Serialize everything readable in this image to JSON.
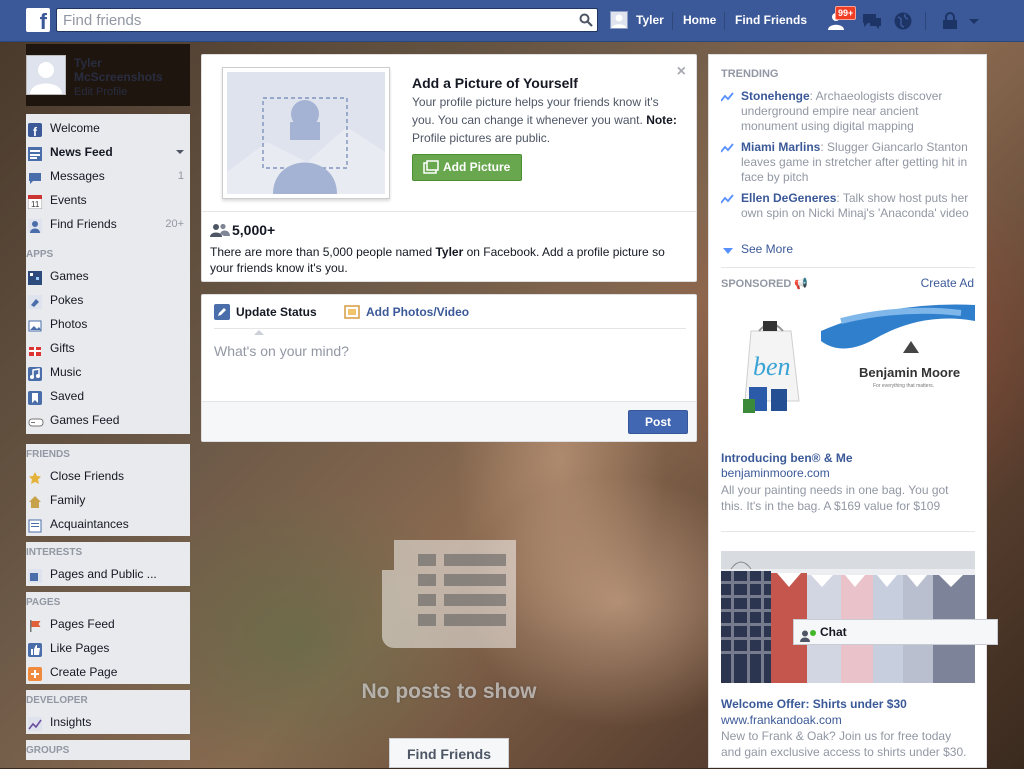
{
  "topbar": {
    "search_placeholder": "Find friends",
    "user_name": "Tyler",
    "home": "Home",
    "find_friends": "Find Friends",
    "friend_requests_badge": "99+"
  },
  "leftnav": {
    "profile": {
      "name": "Tyler McScreenshots",
      "edit": "Edit Profile"
    },
    "favorites": [
      {
        "label": "Welcome",
        "count": "",
        "icon": "fb-icon"
      },
      {
        "label": "News Feed",
        "count": "",
        "icon": "newsfeed-icon"
      },
      {
        "label": "Messages",
        "count": "1",
        "icon": "messages-icon"
      },
      {
        "label": "Events",
        "count": "",
        "icon": "calendar-icon"
      },
      {
        "label": "Find Friends",
        "count": "20+",
        "icon": "find-friends-icon"
      }
    ],
    "apps_heading": "APPS",
    "apps": [
      {
        "label": "Games",
        "icon": "games-icon"
      },
      {
        "label": "Pokes",
        "icon": "pokes-icon"
      },
      {
        "label": "Photos",
        "icon": "photos-icon"
      },
      {
        "label": "Gifts",
        "icon": "gift-icon"
      },
      {
        "label": "Music",
        "icon": "music-icon"
      },
      {
        "label": "Saved",
        "icon": "bookmark-icon"
      },
      {
        "label": "Games Feed",
        "icon": "gamepad-icon"
      }
    ],
    "friends_heading": "FRIENDS",
    "friends": [
      {
        "label": "Close Friends",
        "icon": "star-icon"
      },
      {
        "label": "Family",
        "icon": "house-icon"
      },
      {
        "label": "Acquaintances",
        "icon": "list-icon"
      }
    ],
    "interests_heading": "INTERESTS",
    "interests": [
      {
        "label": "Pages and Public ...",
        "icon": "rss-icon"
      }
    ],
    "pages_heading": "PAGES",
    "pages": [
      {
        "label": "Pages Feed",
        "icon": "flag-icon"
      },
      {
        "label": "Like Pages",
        "icon": "thumbs-up-icon"
      },
      {
        "label": "Create Page",
        "icon": "plus-icon"
      }
    ],
    "developer_heading": "DEVELOPER",
    "developer": [
      {
        "label": "Insights",
        "icon": "chart-icon"
      }
    ],
    "groups_heading": "GROUPS"
  },
  "addpic": {
    "title": "Add a Picture of Yourself",
    "desc": "Your profile picture helps your friends know it's you. You can change it whenever you want.",
    "note_label": "Note:",
    "note_text": " Profile pictures are public.",
    "button": "Add Picture",
    "close": "×",
    "count": "5,000+",
    "count_text_1": "There are more than 5,000 people named ",
    "count_name": "Tyler",
    "count_text_2": " on Facebook. Add a profile picture so your friends know it's you."
  },
  "composer": {
    "tab_status": "Update Status",
    "tab_photos": "Add Photos/Video",
    "placeholder": "What's on your mind?",
    "post": "Post"
  },
  "feed": {
    "empty": "No posts to show",
    "find_friends": "Find Friends"
  },
  "right": {
    "trending_heading": "TRENDING",
    "trending": [
      {
        "name": "Stonehenge",
        "text": ": Archaeologists discover underground empire near ancient monument using digital mapping"
      },
      {
        "name": "Miami Marlins",
        "text": ": Slugger Giancarlo Stanton leaves game in stretcher after getting hit in face by pitch"
      },
      {
        "name": "Ellen DeGeneres",
        "text": ": Talk show host puts her own spin on Nicki Minaj's 'Anaconda' video"
      }
    ],
    "see_more": "See More",
    "sponsored_heading": "SPONSORED",
    "create_ad": "Create Ad",
    "ads": [
      {
        "brand_logo": "Benjamin Moore",
        "brand_tagline": "For everything that matters.",
        "bag_text": "ben",
        "title": "Introducing ben® & Me",
        "url": "benjaminmoore.com",
        "desc": "All your painting needs in one bag. You got this. It's in the bag. A $169 value for $109"
      },
      {
        "title": "Welcome Offer: Shirts under $30",
        "url": "www.frankandoak.com",
        "desc": "New to Frank & Oak? Join us for free today and gain exclusive access to shirts under $30."
      }
    ]
  },
  "chat": {
    "label": "Chat"
  }
}
